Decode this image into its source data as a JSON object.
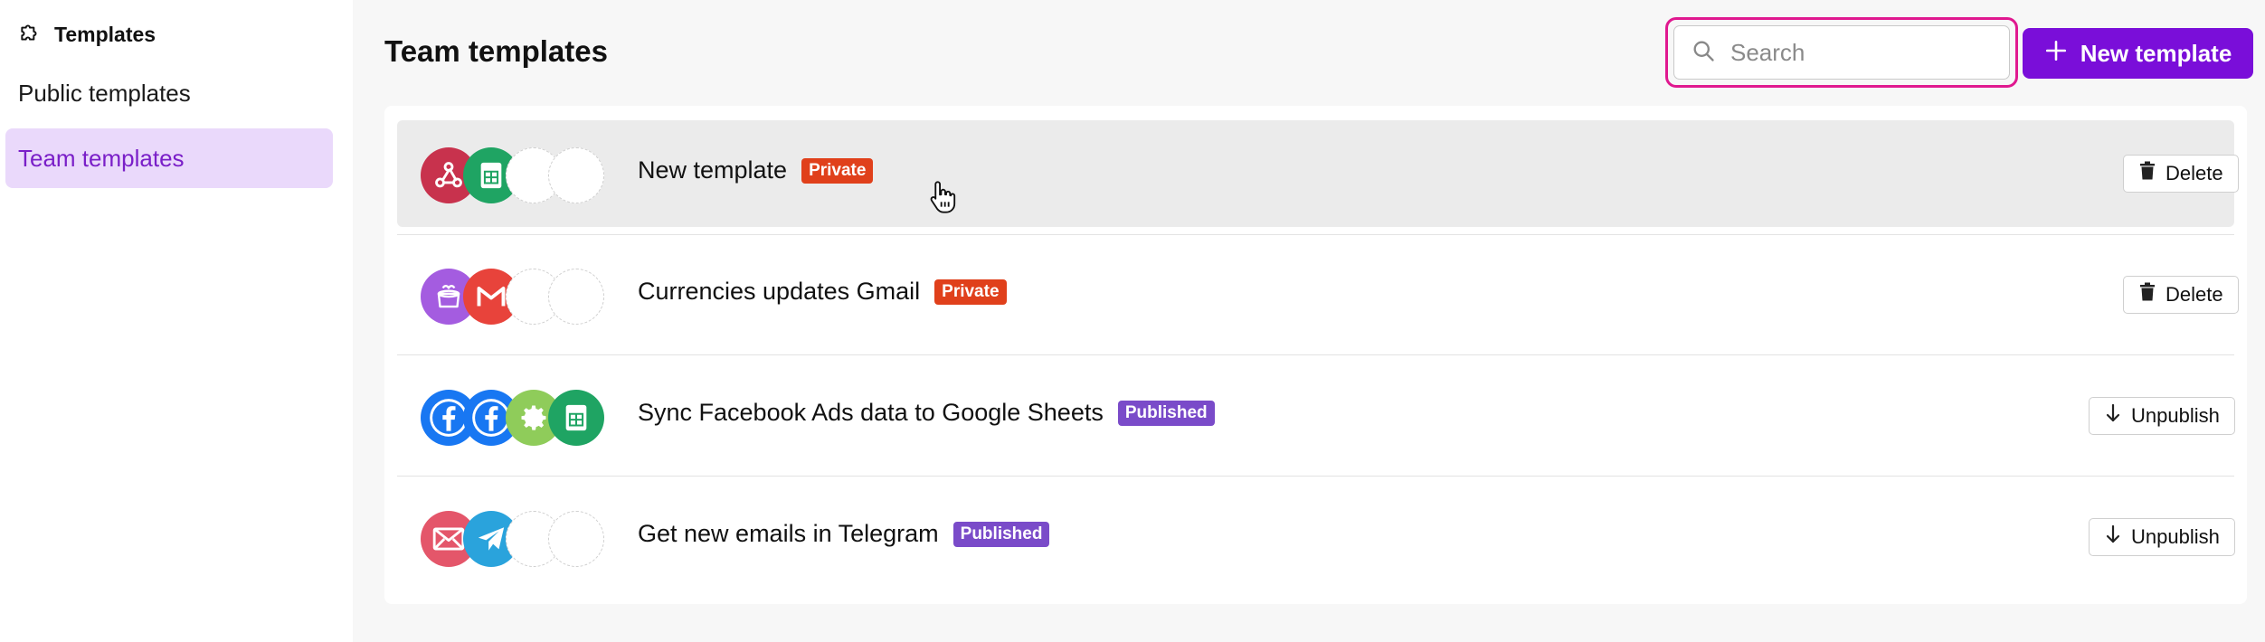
{
  "sidebar": {
    "header_title": "Templates",
    "items": [
      {
        "label": "Public templates",
        "active": false
      },
      {
        "label": "Team templates",
        "active": true
      }
    ]
  },
  "main": {
    "title": "Team templates",
    "search": {
      "placeholder": "Search",
      "value": ""
    },
    "new_button_label": "New template"
  },
  "templates": [
    {
      "name": "New template",
      "badge": "Private",
      "action": "Delete",
      "icons": [
        "webhook-icon",
        "google-sheets-icon",
        "empty",
        "empty"
      ]
    },
    {
      "name": "Currencies updates Gmail",
      "badge": "Private",
      "action": "Delete",
      "icons": [
        "cake-icon",
        "gmail-icon",
        "empty",
        "empty"
      ]
    },
    {
      "name": "Sync Facebook Ads data to Google Sheets",
      "badge": "Published",
      "action": "Unpublish",
      "icons": [
        "facebook-icon",
        "facebook-icon",
        "gear-icon",
        "google-sheets-icon"
      ]
    },
    {
      "name": "Get new emails in Telegram",
      "badge": "Published",
      "action": "Unpublish",
      "icons": [
        "email-icon",
        "telegram-icon",
        "empty",
        "empty"
      ]
    }
  ],
  "colors": {
    "accent": "#7a0ed9",
    "active_bg": "#ead9fb",
    "private_badge": "#e0401b",
    "published_badge": "#7a4bc9",
    "search_highlight": "#e0188f"
  }
}
